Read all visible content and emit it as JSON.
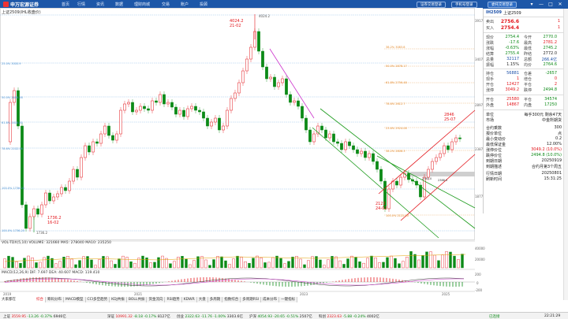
{
  "app": {
    "logo_text": "申万宏源证券",
    "menu": [
      "首页",
      "行情",
      "资讯",
      "数据",
      "理财商城",
      "交易",
      "账户",
      "投顾"
    ],
    "top_buttons": [
      "证券交易登录",
      "手机号登录",
      "委托交易登录"
    ],
    "window_controls": [
      "▾",
      "—",
      "□",
      "✕"
    ]
  },
  "chart": {
    "title": "上证2509(IHL收盘价)",
    "high_label": [
      "4024.2",
      "21-02"
    ],
    "high_inline": "4024.2",
    "low_label": [
      "1736.2",
      "16-02"
    ],
    "low_inline": "1736.2",
    "mid_label": [
      "2122",
      "24-02"
    ],
    "recent_label": [
      "2846",
      "25-07"
    ],
    "ticks_right": [
      "3917",
      "3407",
      "2897",
      "2387",
      "1877"
    ],
    "x_ticks": [
      "2019",
      "2021",
      "2023",
      "2025"
    ],
    "fib_left": [
      "25.0%  3000.9",
      "50.0%  2658.28",
      "61.8%  2418.65",
      "78.6%  2102.56",
      "100.0%  1736.20"
    ],
    "fib_right": [
      "38.2%  3083.8",
      "50.0%  2878.17",
      "61.8%  2756.48",
      "78.6%  2612.7",
      "100.0%  2122.00"
    ],
    "fib_right2": [
      "23.6%  2924.08",
      "38.2%  2806.3",
      "61.8%  2536.7",
      "80.0%  2452.3"
    ],
    "box_labels": [
      "2383.0",
      "2388.0"
    ]
  },
  "volume": {
    "label": "VOL-TDX(5,10) VOLUME: 321660  MA5: 278040  MA10: 235250",
    "scale": [
      "40000",
      "20000"
    ]
  },
  "macd": {
    "label": "MACD(12,26,9) DIF: 7.697  DEA: 40.607  MACD: 119.410",
    "scale": [
      "200",
      "0",
      "-200"
    ]
  },
  "tabs": {
    "left_label": "大家都在",
    "items": [
      "综合",
      "筹码分布",
      "MACD模型",
      "CCI多空趋势",
      "KDJ共振",
      "BOLL共振",
      "资金流向",
      "RSI趋势",
      "KDWR",
      "大盘",
      "多周期",
      "指数综合",
      "多周期RSI",
      "成本分布",
      "一键指标"
    ]
  },
  "panel": {
    "code": "IH2509",
    "name": "上证2509",
    "sell_label": "卖出",
    "sell_price": "2756.6",
    "sell_vol": "1",
    "buy_label": "买入",
    "buy_price": "2754.4",
    "buy_vol": "1",
    "rows1": [
      [
        "现价",
        "2754.4",
        "今开",
        "2770.0"
      ],
      [
        "涨跌",
        "-17.6",
        "最高",
        "2781.2"
      ],
      [
        "涨幅",
        "-0.63%",
        "最低",
        "2745.2"
      ],
      [
        "结算",
        "2755.4",
        "昨结",
        "2772.0"
      ],
      [
        "总量",
        "32117",
        "总额",
        "266.4亿"
      ],
      [
        "振幅",
        "1.15%",
        "均价",
        "2764.6"
      ]
    ],
    "rows2": [
      [
        "持仓",
        "56881",
        "仓差",
        "-2657"
      ],
      [
        "现手",
        "1",
        "增仓",
        "0"
      ],
      [
        "开仓",
        "12427",
        "平仓",
        "2"
      ],
      [
        "涨停",
        "3049.2",
        "跌停",
        "2494.8"
      ]
    ],
    "rows3": [
      [
        "开仓",
        "25580",
        "平仓",
        "34574"
      ],
      [
        "外盘",
        "14867",
        "内盘",
        "17250"
      ]
    ],
    "info": [
      [
        "单位",
        "每手300元  剩余47天"
      ],
      [
        "市场",
        "中金所期货"
      ],
      [
        "合约乘数",
        "300"
      ],
      [
        "报价单位",
        "点"
      ],
      [
        "最小变动价",
        "0.2"
      ],
      [
        "最低保证金",
        "12.00%"
      ],
      [
        "涨停价位",
        "3049.2 (10.0%)"
      ],
      [
        "跌停价位",
        "2494.8 (10.0%)"
      ],
      [
        "到期日期",
        "20250919"
      ],
      [
        "到期描述",
        "合约月第3个周五"
      ],
      [
        "行情日期",
        "20250801"
      ],
      [
        "刷新时间",
        "15:31:25"
      ]
    ]
  },
  "index_bar": [
    {
      "name": "上证",
      "value": "3559.95",
      "chg": "-13.26",
      "pct": "-0.37%",
      "amt": "6946亿"
    },
    {
      "name": "深证",
      "value": "10991.32",
      "chg": "-8.18",
      "pct": "-0.17%",
      "amt": "8127亿"
    },
    {
      "name": "创业",
      "value": "2322.63",
      "chg": "-11.76",
      "pct": "-1.00%",
      "amt": "3303.6亿"
    },
    {
      "name": "沪深",
      "value": "4054.93",
      "chg": "-20.65",
      "pct": "-0.51%",
      "amt": "2507亿"
    },
    {
      "name": "科创",
      "value": "2323.63",
      "chg": "-5.88",
      "pct": "-0.24%",
      "amt": "4002亿"
    }
  ],
  "status_right": [
    "已连接",
    "22:21:29"
  ]
}
